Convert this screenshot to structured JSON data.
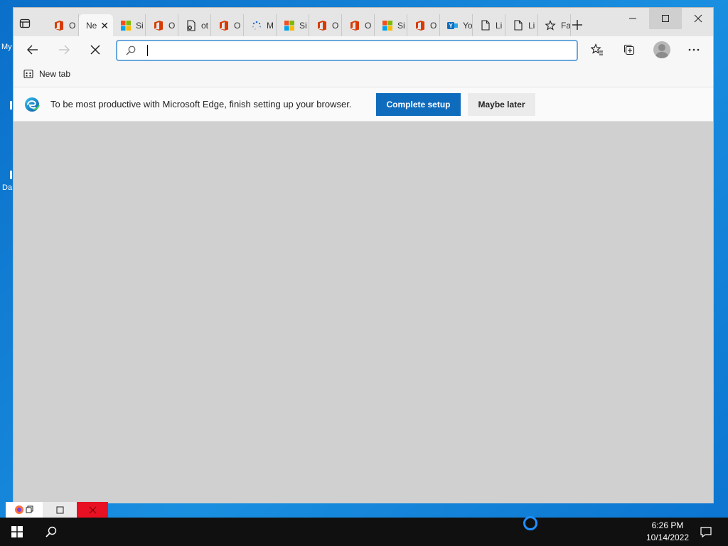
{
  "desktop": {
    "label_top": "My",
    "label_bottom": "Da"
  },
  "tabs": [
    {
      "label": "O",
      "icon": "office-icon"
    },
    {
      "label": "Ne",
      "icon": "new-tab-icon",
      "active": true
    },
    {
      "label": "Si",
      "icon": "microsoft-icon"
    },
    {
      "label": "O",
      "icon": "office-icon"
    },
    {
      "label": "ot",
      "icon": "document-icon"
    },
    {
      "label": "O",
      "icon": "office-icon"
    },
    {
      "label": "M",
      "icon": "loading-icon"
    },
    {
      "label": "Si",
      "icon": "microsoft-icon"
    },
    {
      "label": "O",
      "icon": "office-icon"
    },
    {
      "label": "O",
      "icon": "office-icon"
    },
    {
      "label": "Si",
      "icon": "microsoft-icon"
    },
    {
      "label": "O",
      "icon": "office-icon"
    },
    {
      "label": "Yo",
      "icon": "yammer-icon"
    },
    {
      "label": "Li",
      "icon": "page-icon"
    },
    {
      "label": "Li",
      "icon": "page-icon"
    },
    {
      "label": "Fa",
      "icon": "favorites-icon"
    }
  ],
  "address_bar": {
    "value": "",
    "placeholder": ""
  },
  "favorites_bar": {
    "item_label": "New tab"
  },
  "infobar": {
    "message": "To be most productive with Microsoft Edge, finish setting up your browser.",
    "primary_button": "Complete setup",
    "secondary_button": "Maybe later"
  },
  "taskbar": {
    "time": "6:26 PM",
    "date": "10/14/2022"
  },
  "colors": {
    "accent": "#0f6cbd",
    "desktop": "#0a6fc9",
    "content_bg": "#d0d0d0"
  }
}
